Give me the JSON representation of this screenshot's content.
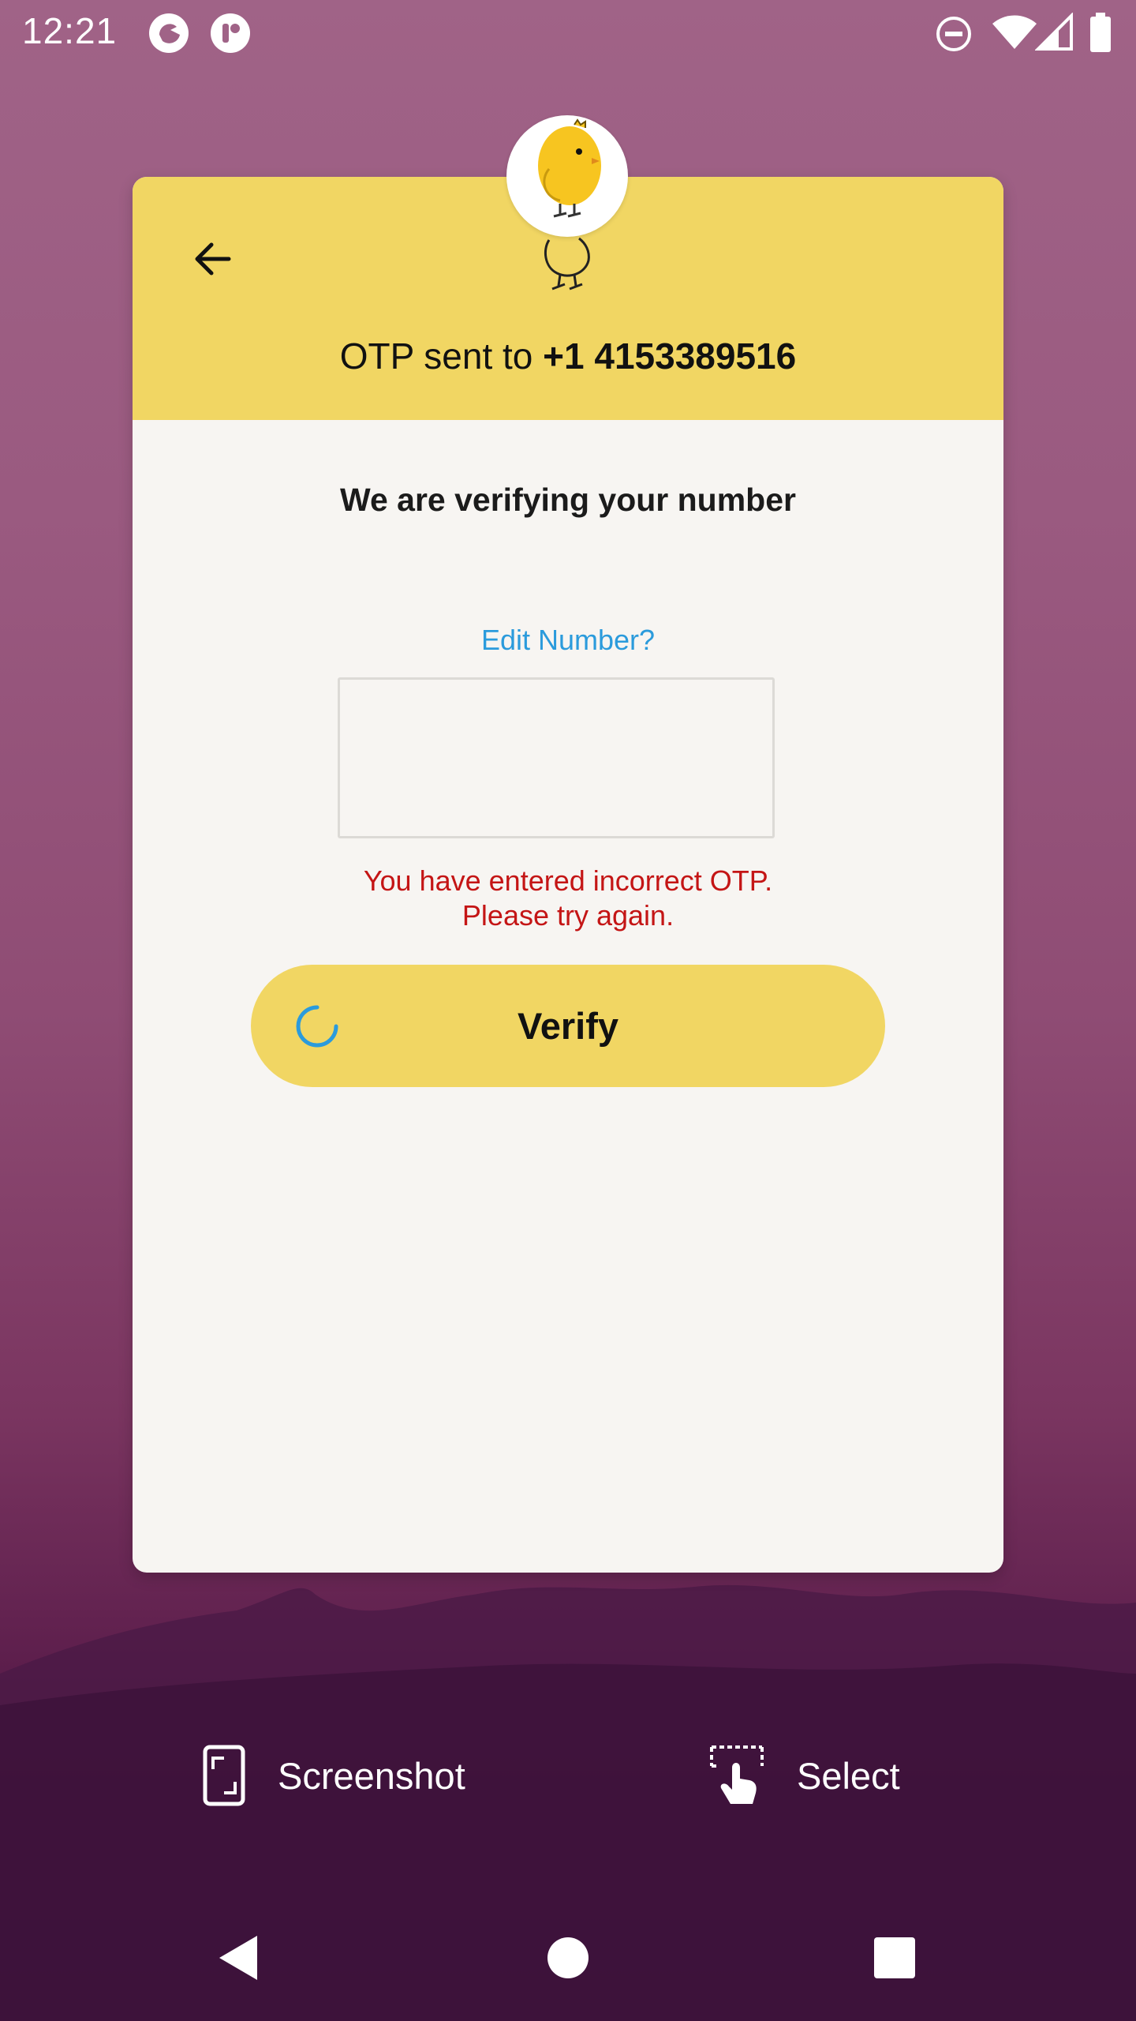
{
  "status_bar": {
    "time": "12:21",
    "icons": [
      "app-icon-1",
      "app-icon-2",
      "do-not-disturb-icon",
      "wifi-icon",
      "cellular-signal-icon",
      "battery-icon"
    ]
  },
  "header": {
    "otp_prefix": "OTP sent to ",
    "phone_number": "+1 4153389516"
  },
  "main": {
    "title": "We are verifying your number",
    "edit_number_link": "Edit Number?",
    "otp_input_value": "",
    "error_line1": "You have entered incorrect OTP.",
    "error_line2": "Please try again.",
    "verify_label": "Verify"
  },
  "bottom_actions": {
    "screenshot_label": "Screenshot",
    "select_label": "Select"
  },
  "colors": {
    "header_yellow": "#f1d663",
    "card_background": "#f7f5f2",
    "link_blue": "#2b9bdc",
    "error_red": "#c41515",
    "chick_yellow": "#f7c520"
  }
}
